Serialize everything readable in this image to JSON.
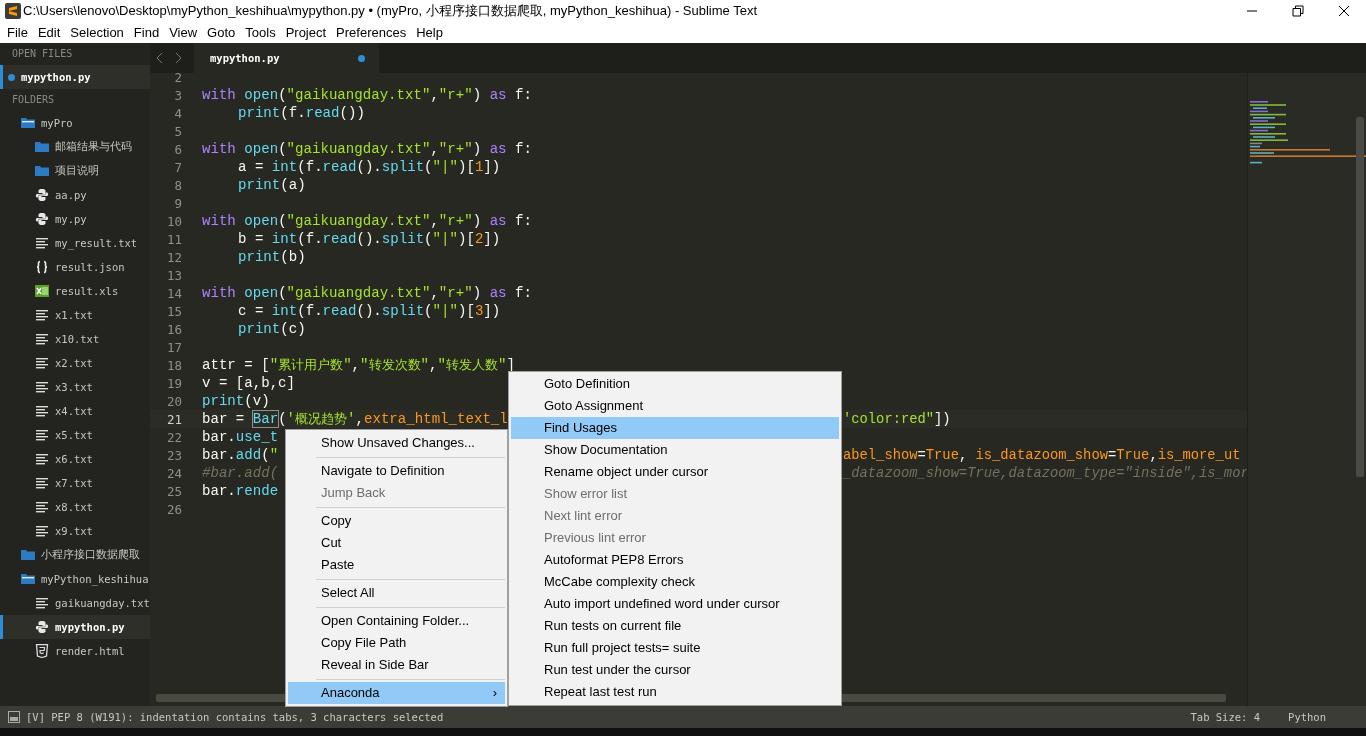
{
  "window": {
    "title": "C:\\Users\\lenovo\\Desktop\\myPython_keshihua\\mypython.py • (myPro, 小程序接口数据爬取, myPython_keshihua) - Sublime Text"
  },
  "menu_bar": [
    "File",
    "Edit",
    "Selection",
    "Find",
    "View",
    "Goto",
    "Tools",
    "Project",
    "Preferences",
    "Help"
  ],
  "sidebar": {
    "open_files_label": "OPEN FILES",
    "open_files": [
      {
        "name": "mypython.py",
        "selected": true,
        "dirty": true
      }
    ],
    "folders_label": "FOLDERS",
    "folders": [
      {
        "name": "myPro",
        "kind": "folder",
        "expanded": true,
        "selected": false,
        "children": [
          {
            "name": "邮箱结果与代码",
            "kind": "folder",
            "selected": false
          },
          {
            "name": "项目说明",
            "kind": "folder",
            "selected": false
          },
          {
            "name": "aa.py",
            "kind": "python",
            "selected": false
          },
          {
            "name": "my.py",
            "kind": "python",
            "selected": false
          },
          {
            "name": "my_result.txt",
            "kind": "text",
            "selected": false
          },
          {
            "name": "result.json",
            "kind": "json",
            "selected": false
          },
          {
            "name": "result.xls",
            "kind": "excel",
            "selected": false
          },
          {
            "name": "x1.txt",
            "kind": "text",
            "selected": false
          },
          {
            "name": "x10.txt",
            "kind": "text",
            "selected": false
          },
          {
            "name": "x2.txt",
            "kind": "text",
            "selected": false
          },
          {
            "name": "x3.txt",
            "kind": "text",
            "selected": false
          },
          {
            "name": "x4.txt",
            "kind": "text",
            "selected": false
          },
          {
            "name": "x5.txt",
            "kind": "text",
            "selected": false
          },
          {
            "name": "x6.txt",
            "kind": "text",
            "selected": false
          },
          {
            "name": "x7.txt",
            "kind": "text",
            "selected": false
          },
          {
            "name": "x8.txt",
            "kind": "text",
            "selected": false
          },
          {
            "name": "x9.txt",
            "kind": "text",
            "selected": false
          }
        ]
      },
      {
        "name": "小程序接口数据爬取",
        "kind": "folder",
        "expanded": false,
        "selected": false
      },
      {
        "name": "myPython_keshihua",
        "kind": "folder",
        "expanded": true,
        "selected": false,
        "children": [
          {
            "name": "gaikuangday.txt",
            "kind": "text",
            "selected": false
          },
          {
            "name": "mypython.py",
            "kind": "python",
            "selected": true
          },
          {
            "name": "render.html",
            "kind": "html",
            "selected": false
          }
        ]
      }
    ]
  },
  "tabs": [
    {
      "label": "mypython.py",
      "selected": true,
      "dirty": true
    }
  ],
  "code": [
    {
      "number": "2",
      "current": false
    },
    {
      "number": "3",
      "current": false,
      "parts": [
        {
          "kind": "kw",
          "text": "with"
        },
        {
          "kind": "fn",
          "text": " open"
        },
        {
          "kind": "plain",
          "text": "("
        },
        {
          "kind": "str",
          "text": "\"gaikuangday.txt\""
        },
        {
          "kind": "plain",
          "text": ","
        },
        {
          "kind": "str",
          "text": "\"r+\""
        },
        {
          "kind": "plain",
          "text": ")"
        },
        {
          "kind": "kw",
          "text": " as"
        },
        {
          "kind": "plain",
          "text": " f:"
        }
      ]
    },
    {
      "number": "4",
      "current": false,
      "indented": true,
      "parts": [
        {
          "kind": "fn",
          "text": "print"
        },
        {
          "kind": "plain",
          "text": "(f."
        },
        {
          "kind": "fn",
          "text": "read"
        },
        {
          "kind": "plain",
          "text": "())"
        }
      ]
    },
    {
      "number": "5",
      "current": false
    },
    {
      "number": "6",
      "current": false,
      "parts": [
        {
          "kind": "kw",
          "text": "with"
        },
        {
          "kind": "fn",
          "text": " open"
        },
        {
          "kind": "plain",
          "text": "("
        },
        {
          "kind": "str",
          "text": "\"gaikuangday.txt\""
        },
        {
          "kind": "plain",
          "text": ","
        },
        {
          "kind": "str",
          "text": "\"r+\""
        },
        {
          "kind": "plain",
          "text": ")"
        },
        {
          "kind": "kw",
          "text": " as"
        },
        {
          "kind": "plain",
          "text": " f:"
        }
      ]
    },
    {
      "number": "7",
      "current": false,
      "indented": true,
      "parts": [
        {
          "kind": "plain",
          "text": "a = "
        },
        {
          "kind": "fn",
          "text": "int"
        },
        {
          "kind": "plain",
          "text": "(f."
        },
        {
          "kind": "fn",
          "text": "read"
        },
        {
          "kind": "plain",
          "text": "()."
        },
        {
          "kind": "fn",
          "text": "split"
        },
        {
          "kind": "plain",
          "text": "("
        },
        {
          "kind": "str",
          "text": "\"|\""
        },
        {
          "kind": "plain",
          "text": ")["
        },
        {
          "kind": "num",
          "text": "1"
        },
        {
          "kind": "plain",
          "text": "])"
        }
      ]
    },
    {
      "number": "8",
      "current": false,
      "indented": true,
      "parts": [
        {
          "kind": "fn",
          "text": "print"
        },
        {
          "kind": "plain",
          "text": "(a)"
        }
      ]
    },
    {
      "number": "9",
      "current": false
    },
    {
      "number": "10",
      "current": false,
      "parts": [
        {
          "kind": "kw",
          "text": "with"
        },
        {
          "kind": "fn",
          "text": " open"
        },
        {
          "kind": "plain",
          "text": "("
        },
        {
          "kind": "str",
          "text": "\"gaikuangday.txt\""
        },
        {
          "kind": "plain",
          "text": ","
        },
        {
          "kind": "str",
          "text": "\"r+\""
        },
        {
          "kind": "plain",
          "text": ")"
        },
        {
          "kind": "kw",
          "text": " as"
        },
        {
          "kind": "plain",
          "text": " f:"
        }
      ]
    },
    {
      "number": "11",
      "current": false,
      "indented": true,
      "parts": [
        {
          "kind": "plain",
          "text": "b = "
        },
        {
          "kind": "fn",
          "text": "int"
        },
        {
          "kind": "plain",
          "text": "(f."
        },
        {
          "kind": "fn",
          "text": "read"
        },
        {
          "kind": "plain",
          "text": "()."
        },
        {
          "kind": "fn",
          "text": "split"
        },
        {
          "kind": "plain",
          "text": "("
        },
        {
          "kind": "str",
          "text": "\"|\""
        },
        {
          "kind": "plain",
          "text": ")["
        },
        {
          "kind": "num",
          "text": "2"
        },
        {
          "kind": "plain",
          "text": "])"
        }
      ]
    },
    {
      "number": "12",
      "current": false,
      "indented": true,
      "parts": [
        {
          "kind": "fn",
          "text": "print"
        },
        {
          "kind": "plain",
          "text": "(b)"
        }
      ]
    },
    {
      "number": "13",
      "current": false
    },
    {
      "number": "14",
      "current": false,
      "parts": [
        {
          "kind": "kw",
          "text": "with"
        },
        {
          "kind": "fn",
          "text": " open"
        },
        {
          "kind": "plain",
          "text": "("
        },
        {
          "kind": "str",
          "text": "\"gaikuangday.txt\""
        },
        {
          "kind": "plain",
          "text": ","
        },
        {
          "kind": "str",
          "text": "\"r+\""
        },
        {
          "kind": "plain",
          "text": ")"
        },
        {
          "kind": "kw",
          "text": " as"
        },
        {
          "kind": "plain",
          "text": " f:"
        }
      ]
    },
    {
      "number": "15",
      "current": false,
      "indented": true,
      "parts": [
        {
          "kind": "plain",
          "text": "c = "
        },
        {
          "kind": "fn",
          "text": "int"
        },
        {
          "kind": "plain",
          "text": "(f."
        },
        {
          "kind": "fn",
          "text": "read"
        },
        {
          "kind": "plain",
          "text": "()."
        },
        {
          "kind": "fn",
          "text": "split"
        },
        {
          "kind": "plain",
          "text": "("
        },
        {
          "kind": "str",
          "text": "\"|\""
        },
        {
          "kind": "plain",
          "text": ")["
        },
        {
          "kind": "num",
          "text": "3"
        },
        {
          "kind": "plain",
          "text": "])"
        }
      ]
    },
    {
      "number": "16",
      "current": false,
      "indented": true,
      "parts": [
        {
          "kind": "fn",
          "text": "print"
        },
        {
          "kind": "plain",
          "text": "(c)"
        }
      ]
    },
    {
      "number": "17",
      "current": false
    },
    {
      "number": "18",
      "current": false,
      "parts": [
        {
          "kind": "plain",
          "text": "attr = ["
        },
        {
          "kind": "str",
          "text": "\"累计用户数\""
        },
        {
          "kind": "plain",
          "text": ","
        },
        {
          "kind": "str",
          "text": "\"转发次数\""
        },
        {
          "kind": "plain",
          "text": ","
        },
        {
          "kind": "str",
          "text": "\"转发人数\""
        },
        {
          "kind": "plain",
          "text": "]"
        }
      ]
    },
    {
      "number": "19",
      "current": false,
      "parts": [
        {
          "kind": "plain",
          "text": "v = [a,b,c]"
        }
      ]
    },
    {
      "number": "20",
      "current": false,
      "parts": [
        {
          "kind": "fn",
          "text": "print"
        },
        {
          "kind": "plain",
          "text": "(v)"
        }
      ]
    },
    {
      "number": "21",
      "current": true,
      "parts": [
        {
          "kind": "plain",
          "text": "bar = "
        },
        {
          "kind": "sel",
          "text": "Bar"
        },
        {
          "kind": "plain",
          "text": "("
        },
        {
          "kind": "str",
          "text": "'概况趋势'"
        },
        {
          "kind": "plain",
          "text": ","
        },
        {
          "kind": "arg",
          "text": "extra_html_text_l"
        }
      ],
      "tail": [
        {
          "kind": "str",
          "text": "'color:red\""
        },
        {
          "kind": "plain",
          "text": "])"
        }
      ]
    },
    {
      "number": "22",
      "current": false,
      "parts": [
        {
          "kind": "plain",
          "text": "bar."
        },
        {
          "kind": "fn",
          "text": "use_t"
        }
      ]
    },
    {
      "number": "23",
      "current": false,
      "parts": [
        {
          "kind": "plain",
          "text": "bar."
        },
        {
          "kind": "fn",
          "text": "add"
        },
        {
          "kind": "plain",
          "text": "("
        },
        {
          "kind": "str",
          "text": "\""
        }
      ],
      "tail": [
        {
          "kind": "arg",
          "text": "abel_show"
        },
        {
          "kind": "plain",
          "text": "="
        },
        {
          "kind": "arg",
          "text": "True"
        },
        {
          "kind": "plain",
          "text": ", "
        },
        {
          "kind": "arg",
          "text": "is_datazoom_show"
        },
        {
          "kind": "plain",
          "text": "="
        },
        {
          "kind": "arg",
          "text": "True"
        },
        {
          "kind": "plain",
          "text": ","
        },
        {
          "kind": "arg",
          "text": "is_more_ut"
        }
      ]
    },
    {
      "number": "24",
      "current": false,
      "parts": [
        {
          "kind": "cmt",
          "text": "#bar.add("
        }
      ],
      "tail": [
        {
          "kind": "cmt",
          "text": "_datazoom_show=True,datazoom_type=\"inside\",is_mor"
        }
      ]
    },
    {
      "number": "25",
      "current": false,
      "parts": [
        {
          "kind": "plain",
          "text": "bar."
        },
        {
          "kind": "fn",
          "text": "rende"
        }
      ]
    },
    {
      "number": "26",
      "current": false
    }
  ],
  "context_menu": [
    {
      "kind": "item",
      "label": "Show Unsaved Changes...",
      "disabled": false,
      "selected": false
    },
    {
      "kind": "separator"
    },
    {
      "kind": "item",
      "label": "Navigate to Definition",
      "disabled": false,
      "selected": false
    },
    {
      "kind": "item",
      "label": "Jump Back",
      "disabled": true,
      "selected": false
    },
    {
      "kind": "separator"
    },
    {
      "kind": "item",
      "label": "Copy",
      "disabled": false,
      "selected": false
    },
    {
      "kind": "item",
      "label": "Cut",
      "disabled": false,
      "selected": false
    },
    {
      "kind": "item",
      "label": "Paste",
      "disabled": false,
      "selected": false
    },
    {
      "kind": "separator"
    },
    {
      "kind": "item",
      "label": "Select All",
      "disabled": false,
      "selected": false
    },
    {
      "kind": "separator"
    },
    {
      "kind": "item",
      "label": "Open Containing Folder...",
      "disabled": false,
      "selected": false
    },
    {
      "kind": "item",
      "label": "Copy File Path",
      "disabled": false,
      "selected": false
    },
    {
      "kind": "item",
      "label": "Reveal in Side Bar",
      "disabled": false,
      "selected": false
    },
    {
      "kind": "separator"
    },
    {
      "kind": "submenu",
      "label": "Anaconda",
      "arrow": "›",
      "disabled": false,
      "selected": true
    }
  ],
  "submenu": [
    {
      "label": "Goto Definition",
      "disabled": false,
      "selected": false
    },
    {
      "label": "Goto Assignment",
      "disabled": false,
      "selected": false
    },
    {
      "label": "Find Usages",
      "disabled": false,
      "selected": true
    },
    {
      "label": "Show Documentation",
      "disabled": false,
      "selected": false
    },
    {
      "label": "Rename object under cursor",
      "disabled": false,
      "selected": false
    },
    {
      "label": "Show error list",
      "disabled": true,
      "selected": false
    },
    {
      "label": "Next lint error",
      "disabled": true,
      "selected": false
    },
    {
      "label": "Previous lint error",
      "disabled": true,
      "selected": false
    },
    {
      "label": "Autoformat PEP8 Errors",
      "disabled": false,
      "selected": false
    },
    {
      "label": "McCabe complexity check",
      "disabled": false,
      "selected": false
    },
    {
      "label": "Auto import undefined word under cursor",
      "disabled": false,
      "selected": false
    },
    {
      "label": "Run tests on current file",
      "disabled": false,
      "selected": false
    },
    {
      "label": "Run full project tests= suite",
      "disabled": false,
      "selected": false
    },
    {
      "label": "Run test under the cursor",
      "disabled": false,
      "selected": false
    },
    {
      "label": "Repeat last test run",
      "disabled": false,
      "selected": false
    }
  ],
  "status_bar": {
    "message": "[V] PEP 8 (W191): indentation contains tabs, 3 characters selected",
    "tab_size": "Tab Size: 4",
    "syntax": "Python"
  }
}
